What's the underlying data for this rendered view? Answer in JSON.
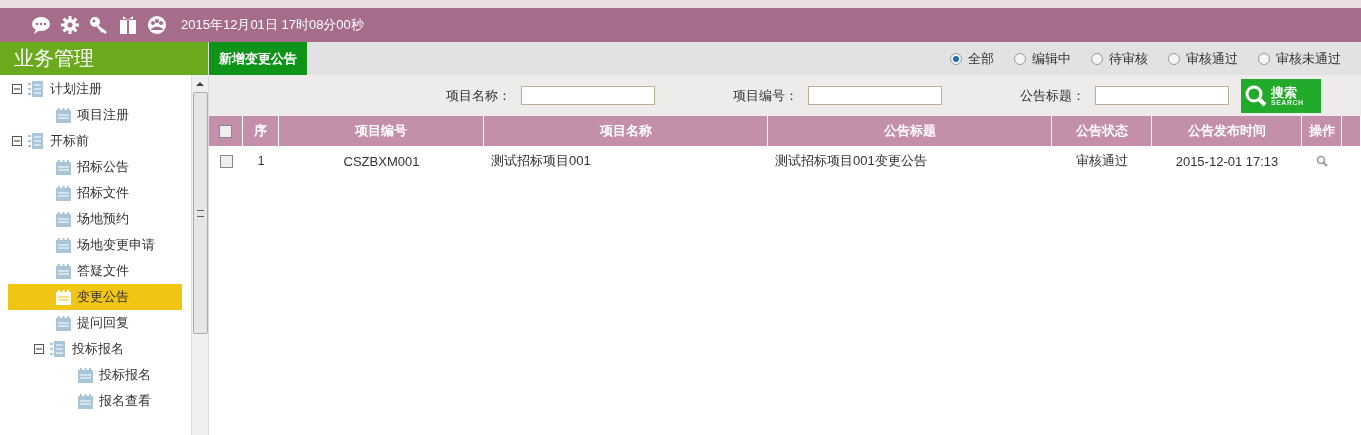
{
  "header": {
    "datetime": "2015年12月01日 17时08分00秒"
  },
  "sidebar": {
    "title": "业务管理",
    "tree": [
      {
        "label": "计划注册",
        "kind": "group",
        "expanded": true,
        "selected": false,
        "children": [
          {
            "label": "项目注册",
            "kind": "leaf",
            "selected": false
          }
        ]
      },
      {
        "label": "开标前",
        "kind": "group",
        "expanded": true,
        "selected": false,
        "children": [
          {
            "label": "招标公告",
            "kind": "leaf",
            "selected": false
          },
          {
            "label": "招标文件",
            "kind": "leaf",
            "selected": false
          },
          {
            "label": "场地预约",
            "kind": "leaf",
            "selected": false
          },
          {
            "label": "场地变更申请",
            "kind": "leaf",
            "selected": false
          },
          {
            "label": "答疑文件",
            "kind": "leaf",
            "selected": false
          },
          {
            "label": "变更公告",
            "kind": "leaf",
            "selected": true
          },
          {
            "label": "提问回复",
            "kind": "leaf",
            "selected": false
          },
          {
            "label": "投标报名",
            "kind": "group",
            "expanded": true,
            "selected": false,
            "children": [
              {
                "label": "投标报名",
                "kind": "leaf",
                "selected": false
              },
              {
                "label": "报名查看",
                "kind": "leaf",
                "selected": false
              }
            ]
          }
        ]
      }
    ]
  },
  "tabs": [
    {
      "label": "新增变更公告",
      "selected": true
    }
  ],
  "status_filter": [
    {
      "label": "全部",
      "selected": true
    },
    {
      "label": "编辑中",
      "selected": false
    },
    {
      "label": "待审核",
      "selected": false
    },
    {
      "label": "审核通过",
      "selected": false
    },
    {
      "label": "审核未通过",
      "selected": false
    }
  ],
  "search": {
    "fields": [
      {
        "label": "项目名称："
      },
      {
        "label": "项目编号："
      },
      {
        "label": "公告标题："
      }
    ],
    "button": {
      "label": "搜索",
      "sublabel": "SEARCH"
    }
  },
  "table": {
    "columns": [
      "序",
      "项目编号",
      "项目名称",
      "公告标题",
      "公告状态",
      "公告发布时间",
      "操作"
    ],
    "header_checked": false,
    "rows": [
      {
        "checked": false,
        "cells": [
          "1",
          "CSZBXM001",
          "测试招标项目001",
          "测试招标项目001变更公告",
          "审核通过",
          "2015-12-01 17:13"
        ]
      }
    ]
  }
}
